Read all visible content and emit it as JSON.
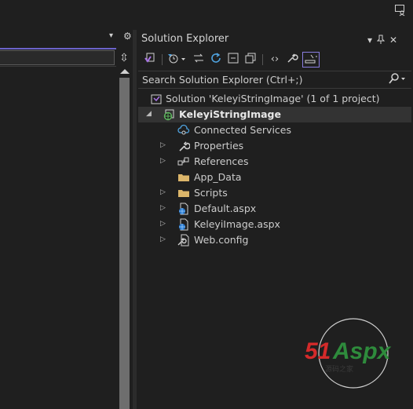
{
  "window": {
    "feedback_icon": "feedback-icon"
  },
  "left_pane": {
    "dropdown_glyph": "▾",
    "gear_glyph": "⚙",
    "split_glyph": "⇳"
  },
  "solution_explorer": {
    "title": "Solution Explorer",
    "title_buttons": [
      "▾",
      "⊓",
      "✕"
    ],
    "search_placeholder": "Search Solution Explorer (Ctrl+;)",
    "tree": [
      {
        "label": "Solution 'KeleyiStringImage' (1 of 1 project)",
        "icon": "solution-icon",
        "depth": 0,
        "expander": ""
      },
      {
        "label": "KeleyiStringImage",
        "icon": "web-project-icon",
        "depth": 1,
        "expander": "◢",
        "bold": true,
        "selected": true
      },
      {
        "label": "Connected Services",
        "icon": "connected-services-icon",
        "depth": 2,
        "expander": ""
      },
      {
        "label": "Properties",
        "icon": "wrench-icon",
        "depth": 2,
        "expander": "▷"
      },
      {
        "label": "References",
        "icon": "references-icon",
        "depth": 2,
        "expander": "▷"
      },
      {
        "label": "App_Data",
        "icon": "folder-icon",
        "depth": 2,
        "expander": ""
      },
      {
        "label": "Scripts",
        "icon": "folder-icon",
        "depth": 2,
        "expander": "▷"
      },
      {
        "label": "Default.aspx",
        "icon": "web-page-icon",
        "depth": 2,
        "expander": "▷"
      },
      {
        "label": "KeleyiImage.aspx",
        "icon": "web-page-icon",
        "depth": 2,
        "expander": "▷"
      },
      {
        "label": "Web.config",
        "icon": "config-file-icon",
        "depth": 2,
        "expander": "▷"
      }
    ]
  },
  "watermark": {
    "brand_red": "51",
    "brand_green": "Aspx",
    "sub": "源码之家"
  },
  "colors": {
    "accent": "#6b63c9",
    "selected_row": "#333333",
    "brand_red": "#d42a2a",
    "brand_green": "#2e8b3c"
  }
}
